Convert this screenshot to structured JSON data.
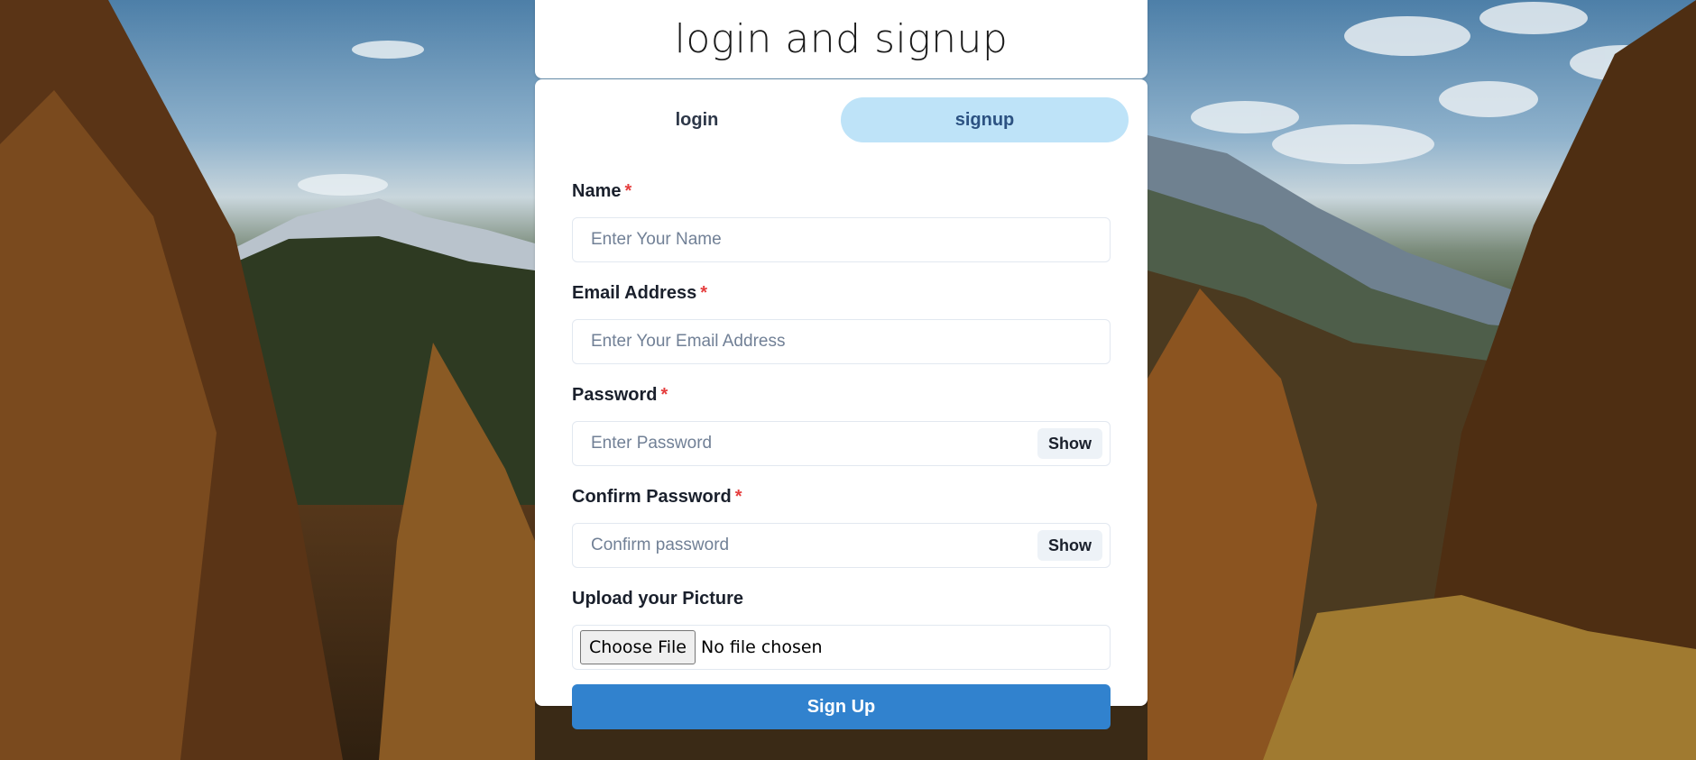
{
  "header": {
    "title": "login and signup"
  },
  "tabs": [
    {
      "label": "login",
      "active": false
    },
    {
      "label": "signup",
      "active": true
    }
  ],
  "form": {
    "name": {
      "label": "Name",
      "required_mark": "*",
      "placeholder": "Enter Your Name",
      "value": ""
    },
    "email": {
      "label": "Email Address",
      "required_mark": "*",
      "placeholder": "Enter Your Email Address",
      "value": ""
    },
    "password": {
      "label": "Password",
      "required_mark": "*",
      "placeholder": "Enter Password",
      "value": "",
      "toggle_label": "Show"
    },
    "confirm_password": {
      "label": "Confirm Password",
      "required_mark": "*",
      "placeholder": "Confirm password",
      "value": "",
      "toggle_label": "Show"
    },
    "picture": {
      "label": "Upload your Picture",
      "button_label": "Choose File",
      "status": "No file chosen"
    },
    "submit_label": "Sign Up"
  },
  "colors": {
    "accent": "#3182ce",
    "active_tab_bg": "#bee3f8",
    "required": "#e53e3e"
  }
}
